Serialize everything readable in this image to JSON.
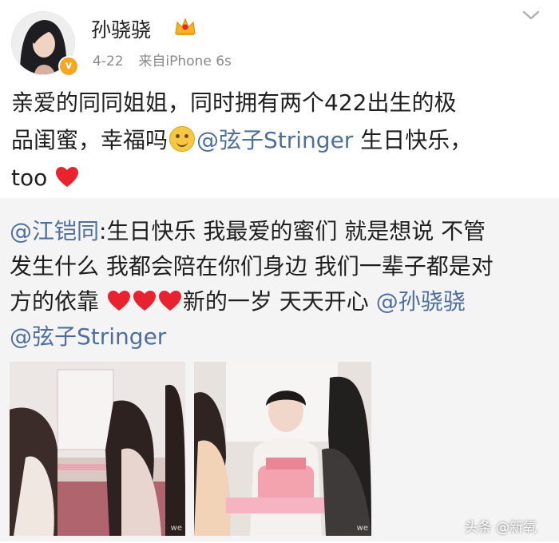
{
  "user": {
    "name": "孙骁骁",
    "verified_mark": "v",
    "date": "4-22",
    "source": "来自iPhone 6s"
  },
  "post": {
    "line1": "亲爱的同同姐姐，同时拥有两个422出生的极",
    "line2a": "品闺蜜，幸福吗",
    "mention": "@弦子Stringer",
    "line2b": " 生日快乐，",
    "line3": "too"
  },
  "repost": {
    "author_mention": "@江铠同",
    "line1": ":生日快乐 我最爱的蜜们 就是想说 不管",
    "line2": "发生什么 我都会陪在你们身边 我们一辈子都是对",
    "line3a": "方的依靠 ",
    "line3b": "新的一岁 天天开心 ",
    "mention1": "@孙骁骁",
    "mention2": "@弦子Stringer",
    "photo_watermark": "we"
  },
  "footer": {
    "source_label": "头条 @新氧"
  },
  "colors": {
    "mention": "#4e6f9e",
    "heart": "#e8232f",
    "repost_bg": "#f4f4f4",
    "verified": "#f5a623"
  },
  "icons": [
    "crown-icon",
    "chevron-down-icon",
    "smile-emoji-icon",
    "heart-icon",
    "verified-icon"
  ]
}
